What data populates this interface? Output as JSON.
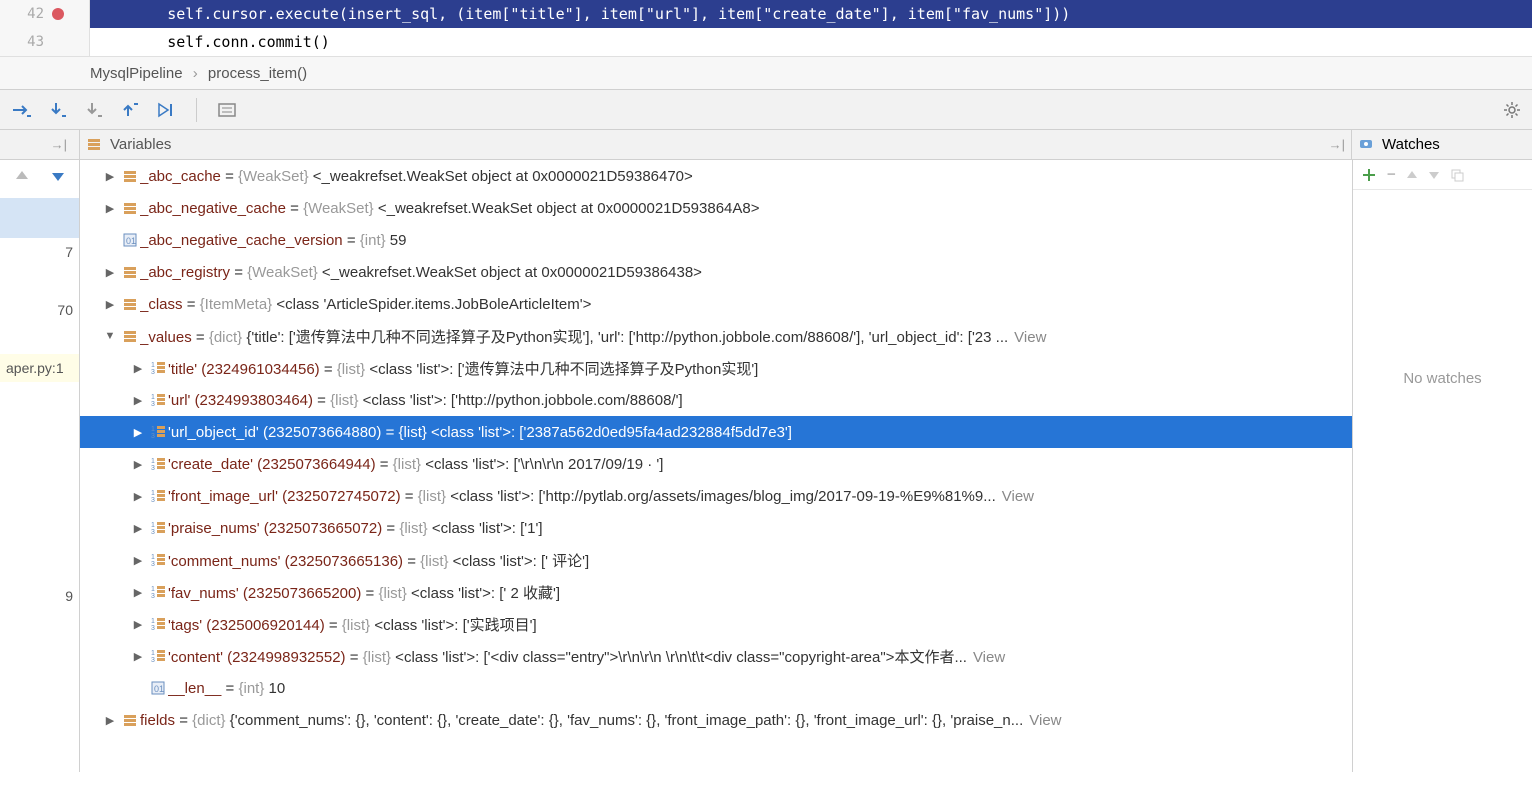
{
  "editor": {
    "line42_num": "42",
    "line43_num": "43",
    "code42": "        self.cursor.execute(insert_sql, (item[\"title\"], item[\"url\"], item[\"create_date\"], item[\"fav_nums\"]))",
    "code43": "        self.conn.commit()"
  },
  "breadcrumb": {
    "a": "MysqlPipeline",
    "b": "process_item()"
  },
  "panels": {
    "variables": "Variables",
    "watches": "Watches",
    "no_watches": "No watches"
  },
  "frames": {
    "f1": "7",
    "f2": "70",
    "f3": "aper.py:1",
    "f4": "9"
  },
  "vars": [
    {
      "indent": 0,
      "arrow": "▶",
      "ico": "obj",
      "name": "_abc_cache",
      "eq": " = ",
      "type": "{WeakSet}",
      "val": " <_weakrefset.WeakSet object at 0x0000021D59386470>"
    },
    {
      "indent": 0,
      "arrow": "▶",
      "ico": "obj",
      "name": "_abc_negative_cache",
      "eq": " = ",
      "type": "{WeakSet}",
      "val": " <_weakrefset.WeakSet object at 0x0000021D593864A8>"
    },
    {
      "indent": 0,
      "arrow": "",
      "ico": "num",
      "name": "_abc_negative_cache_version",
      "eq": " = ",
      "type": "{int}",
      "val": " 59"
    },
    {
      "indent": 0,
      "arrow": "▶",
      "ico": "obj",
      "name": "_abc_registry",
      "eq": " = ",
      "type": "{WeakSet}",
      "val": " <_weakrefset.WeakSet object at 0x0000021D59386438>"
    },
    {
      "indent": 0,
      "arrow": "▶",
      "ico": "obj",
      "name": "_class",
      "eq": " = ",
      "type": "{ItemMeta}",
      "val": " <class 'ArticleSpider.items.JobBoleArticleItem'>"
    },
    {
      "indent": 0,
      "arrow": "▼",
      "ico": "obj",
      "name": "_values",
      "eq": " = ",
      "type": "{dict}",
      "val": " {'title': ['遗传算法中几种不同选择算子及Python实现'], 'url': ['http://python.jobbole.com/88608/'], 'url_object_id': ['23 ...",
      "view": "View"
    },
    {
      "indent": 1,
      "arrow": "▶",
      "ico": "lst",
      "name": "'title' (2324961034456)",
      "eq": " = ",
      "type": "{list}",
      "val": " <class 'list'>: ['遗传算法中几种不同选择算子及Python实现']"
    },
    {
      "indent": 1,
      "arrow": "▶",
      "ico": "lst",
      "name": "'url' (2324993803464)",
      "eq": " = ",
      "type": "{list}",
      "val": " <class 'list'>: ['http://python.jobbole.com/88608/']"
    },
    {
      "indent": 1,
      "arrow": "▶",
      "ico": "lst",
      "name": "'url_object_id' (2325073664880)",
      "eq": " = ",
      "type": "{list}",
      "val": " <class 'list'>: ['2387a562d0ed95fa4ad232884f5dd7e3']",
      "sel": true
    },
    {
      "indent": 1,
      "arrow": "▶",
      "ico": "lst",
      "name": "'create_date' (2325073664944)",
      "eq": " = ",
      "type": "{list}",
      "val": " <class 'list'>: ['\\r\\n\\r\\n            2017/09/19 ·  ']"
    },
    {
      "indent": 1,
      "arrow": "▶",
      "ico": "lst",
      "name": "'front_image_url' (2325072745072)",
      "eq": " = ",
      "type": "{list}",
      "val": " <class 'list'>: ['http://pytlab.org/assets/images/blog_img/2017-09-19-%E9%81%9...",
      "view": "View"
    },
    {
      "indent": 1,
      "arrow": "▶",
      "ico": "lst",
      "name": "'praise_nums' (2325073665072)",
      "eq": " = ",
      "type": "{list}",
      "val": " <class 'list'>: ['1']"
    },
    {
      "indent": 1,
      "arrow": "▶",
      "ico": "lst",
      "name": "'comment_nums' (2325073665136)",
      "eq": " = ",
      "type": "{list}",
      "val": " <class 'list'>: [' 评论']"
    },
    {
      "indent": 1,
      "arrow": "▶",
      "ico": "lst",
      "name": "'fav_nums' (2325073665200)",
      "eq": " = ",
      "type": "{list}",
      "val": " <class 'list'>: [' 2 收藏']"
    },
    {
      "indent": 1,
      "arrow": "▶",
      "ico": "lst",
      "name": "'tags' (2325006920144)",
      "eq": " = ",
      "type": "{list}",
      "val": " <class 'list'>: ['实践项目']"
    },
    {
      "indent": 1,
      "arrow": "▶",
      "ico": "lst",
      "name": "'content' (2324998932552)",
      "eq": " = ",
      "type": "{list}",
      "val": " <class 'list'>: ['<div class=\"entry\">\\r\\n\\r\\n        \\r\\n\\t\\t<div class=\"copyright-area\">本文作者...",
      "view": "View"
    },
    {
      "indent": 1,
      "arrow": "",
      "ico": "num",
      "name": "__len__",
      "eq": " = ",
      "type": "{int}",
      "val": " 10"
    },
    {
      "indent": 0,
      "arrow": "▶",
      "ico": "obj",
      "name": "fields",
      "eq": " = ",
      "type": "{dict}",
      "val": " {'comment_nums': {}, 'content': {}, 'create_date': {}, 'fav_nums': {}, 'front_image_path': {}, 'front_image_url': {}, 'praise_n...",
      "view": "View"
    }
  ]
}
